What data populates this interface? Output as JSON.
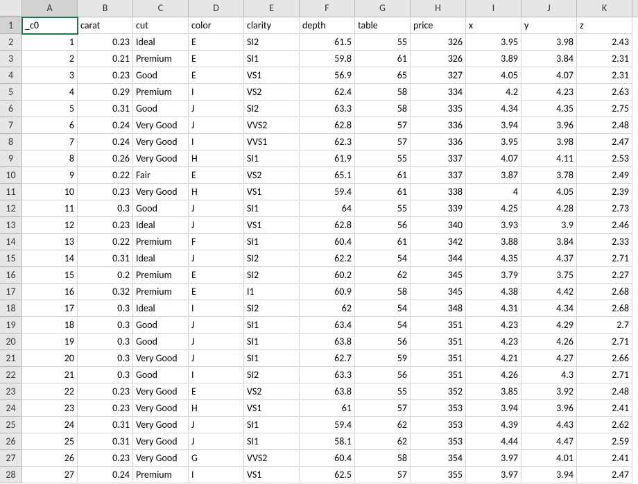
{
  "selected_cell": {
    "row": 1,
    "col": "A"
  },
  "columns": [
    "A",
    "B",
    "C",
    "D",
    "E",
    "F",
    "G",
    "H",
    "I",
    "J",
    "K"
  ],
  "col_types": [
    "number",
    "number",
    "text",
    "text",
    "text",
    "number",
    "number",
    "number",
    "number",
    "number",
    "number"
  ],
  "headers": [
    "_c0",
    "carat",
    "cut",
    "color",
    "clarity",
    "depth",
    "table",
    "price",
    "x",
    "y",
    "z"
  ],
  "rows": [
    [
      "1",
      "0.23",
      "Ideal",
      "E",
      "SI2",
      "61.5",
      "55",
      "326",
      "3.95",
      "3.98",
      "2.43"
    ],
    [
      "2",
      "0.21",
      "Premium",
      "E",
      "SI1",
      "59.8",
      "61",
      "326",
      "3.89",
      "3.84",
      "2.31"
    ],
    [
      "3",
      "0.23",
      "Good",
      "E",
      "VS1",
      "56.9",
      "65",
      "327",
      "4.05",
      "4.07",
      "2.31"
    ],
    [
      "4",
      "0.29",
      "Premium",
      "I",
      "VS2",
      "62.4",
      "58",
      "334",
      "4.2",
      "4.23",
      "2.63"
    ],
    [
      "5",
      "0.31",
      "Good",
      "J",
      "SI2",
      "63.3",
      "58",
      "335",
      "4.34",
      "4.35",
      "2.75"
    ],
    [
      "6",
      "0.24",
      "Very Good",
      "J",
      "VVS2",
      "62.8",
      "57",
      "336",
      "3.94",
      "3.96",
      "2.48"
    ],
    [
      "7",
      "0.24",
      "Very Good",
      "I",
      "VVS1",
      "62.3",
      "57",
      "336",
      "3.95",
      "3.98",
      "2.47"
    ],
    [
      "8",
      "0.26",
      "Very Good",
      "H",
      "SI1",
      "61.9",
      "55",
      "337",
      "4.07",
      "4.11",
      "2.53"
    ],
    [
      "9",
      "0.22",
      "Fair",
      "E",
      "VS2",
      "65.1",
      "61",
      "337",
      "3.87",
      "3.78",
      "2.49"
    ],
    [
      "10",
      "0.23",
      "Very Good",
      "H",
      "VS1",
      "59.4",
      "61",
      "338",
      "4",
      "4.05",
      "2.39"
    ],
    [
      "11",
      "0.3",
      "Good",
      "J",
      "SI1",
      "64",
      "55",
      "339",
      "4.25",
      "4.28",
      "2.73"
    ],
    [
      "12",
      "0.23",
      "Ideal",
      "J",
      "VS1",
      "62.8",
      "56",
      "340",
      "3.93",
      "3.9",
      "2.46"
    ],
    [
      "13",
      "0.22",
      "Premium",
      "F",
      "SI1",
      "60.4",
      "61",
      "342",
      "3.88",
      "3.84",
      "2.33"
    ],
    [
      "14",
      "0.31",
      "Ideal",
      "J",
      "SI2",
      "62.2",
      "54",
      "344",
      "4.35",
      "4.37",
      "2.71"
    ],
    [
      "15",
      "0.2",
      "Premium",
      "E",
      "SI2",
      "60.2",
      "62",
      "345",
      "3.79",
      "3.75",
      "2.27"
    ],
    [
      "16",
      "0.32",
      "Premium",
      "E",
      "I1",
      "60.9",
      "58",
      "345",
      "4.38",
      "4.42",
      "2.68"
    ],
    [
      "17",
      "0.3",
      "Ideal",
      "I",
      "SI2",
      "62",
      "54",
      "348",
      "4.31",
      "4.34",
      "2.68"
    ],
    [
      "18",
      "0.3",
      "Good",
      "J",
      "SI1",
      "63.4",
      "54",
      "351",
      "4.23",
      "4.29",
      "2.7"
    ],
    [
      "19",
      "0.3",
      "Good",
      "J",
      "SI1",
      "63.8",
      "56",
      "351",
      "4.23",
      "4.26",
      "2.71"
    ],
    [
      "20",
      "0.3",
      "Very Good",
      "J",
      "SI1",
      "62.7",
      "59",
      "351",
      "4.21",
      "4.27",
      "2.66"
    ],
    [
      "21",
      "0.3",
      "Good",
      "I",
      "SI2",
      "63.3",
      "56",
      "351",
      "4.26",
      "4.3",
      "2.71"
    ],
    [
      "22",
      "0.23",
      "Very Good",
      "E",
      "VS2",
      "63.8",
      "55",
      "352",
      "3.85",
      "3.92",
      "2.48"
    ],
    [
      "23",
      "0.23",
      "Very Good",
      "H",
      "VS1",
      "61",
      "57",
      "353",
      "3.94",
      "3.96",
      "2.41"
    ],
    [
      "24",
      "0.31",
      "Very Good",
      "J",
      "SI1",
      "59.4",
      "62",
      "353",
      "4.39",
      "4.43",
      "2.62"
    ],
    [
      "25",
      "0.31",
      "Very Good",
      "J",
      "SI1",
      "58.1",
      "62",
      "353",
      "4.44",
      "4.47",
      "2.59"
    ],
    [
      "26",
      "0.23",
      "Very Good",
      "G",
      "VVS2",
      "60.4",
      "58",
      "354",
      "3.97",
      "4.01",
      "2.41"
    ],
    [
      "27",
      "0.24",
      "Premium",
      "I",
      "VS1",
      "62.5",
      "57",
      "355",
      "3.97",
      "3.94",
      "2.47"
    ]
  ]
}
